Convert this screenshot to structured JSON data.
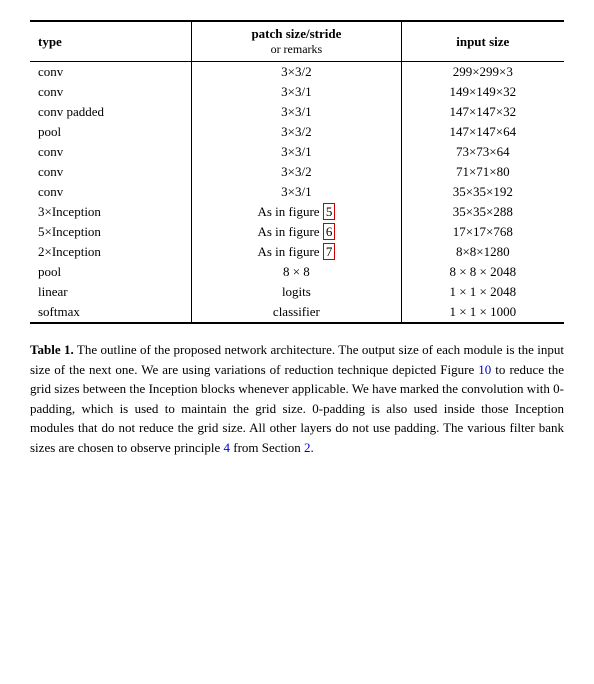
{
  "table": {
    "headers": {
      "col1": "type",
      "col2_main": "patch size/stride",
      "col2_sub": "or remarks",
      "col3": "input size"
    },
    "rows": [
      {
        "type": "conv",
        "patch": "3×3/2",
        "input": "299×299×3"
      },
      {
        "type": "conv",
        "patch": "3×3/1",
        "input": "149×149×32"
      },
      {
        "type": "conv padded",
        "patch": "3×3/1",
        "input": "147×147×32"
      },
      {
        "type": "pool",
        "patch": "3×3/2",
        "input": "147×147×64"
      },
      {
        "type": "conv",
        "patch": "3×3/1",
        "input": "73×73×64"
      },
      {
        "type": "conv",
        "patch": "3×3/2",
        "input": "71×71×80"
      },
      {
        "type": "conv",
        "patch": "3×3/1",
        "input": "35×35×192"
      },
      {
        "type": "3×Inception",
        "patch_prefix": "As in figure ",
        "patch_ref": "5",
        "patch_ref_boxed": true,
        "input": "35×35×288"
      },
      {
        "type": "5×Inception",
        "patch_prefix": "As in figure ",
        "patch_ref": "6",
        "patch_ref_boxed": true,
        "input": "17×17×768"
      },
      {
        "type": "2×Inception",
        "patch_prefix": "As in figure ",
        "patch_ref": "7",
        "patch_ref_boxed": true,
        "input": "8×8×1280"
      },
      {
        "type": "pool",
        "patch": "8 × 8",
        "input": "8 × 8 × 2048"
      },
      {
        "type": "linear",
        "patch": "logits",
        "input": "1 × 1 × 2048"
      },
      {
        "type": "softmax",
        "patch": "classifier",
        "input": "1 × 1 × 1000"
      }
    ]
  },
  "caption": {
    "label": "Table 1.",
    "text": " The outline of the proposed network architecture.  The output size of each module is the input size of the next one.  We are using variations of reduction technique depicted Figure ",
    "ref_10": "10",
    "text2": " to reduce the grid sizes between the Inception blocks whenever applicable.  We have marked the convolution with 0-padding, which is used to maintain the grid size.  0-padding is also used inside those Inception modules that do not reduce the grid size.  All other layers do not use padding.  The various filter bank sizes are chosen to observe principle ",
    "ref_4": "4",
    "text3": " from Section ",
    "ref_2": "2",
    "text4": "."
  }
}
